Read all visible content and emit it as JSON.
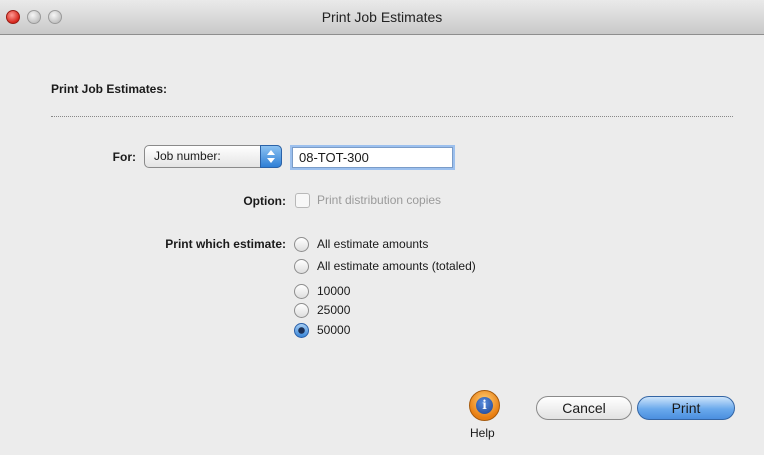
{
  "window": {
    "title": "Print Job Estimates"
  },
  "section": {
    "title": "Print Job Estimates:"
  },
  "for_row": {
    "label": "For:",
    "popup_value": "Job number:",
    "job_value": "08-TOT-300"
  },
  "option_row": {
    "label": "Option:",
    "checkbox_label": "Print distribution copies",
    "checked": false,
    "enabled": false
  },
  "estimate": {
    "label": "Print which estimate:",
    "options": [
      {
        "label": "All estimate amounts",
        "selected": false
      },
      {
        "label": "All estimate amounts (totaled)",
        "selected": false
      },
      {
        "label": "10000",
        "selected": false
      },
      {
        "label": "25000",
        "selected": false
      },
      {
        "label": "50000",
        "selected": true
      }
    ]
  },
  "footer": {
    "help_label": "Help",
    "help_icon": "info-icon",
    "cancel_label": "Cancel",
    "print_label": "Print"
  },
  "colors": {
    "accent": "#4b8fdf",
    "help_orange": "#e87d10",
    "close_red": "#d6261c"
  }
}
